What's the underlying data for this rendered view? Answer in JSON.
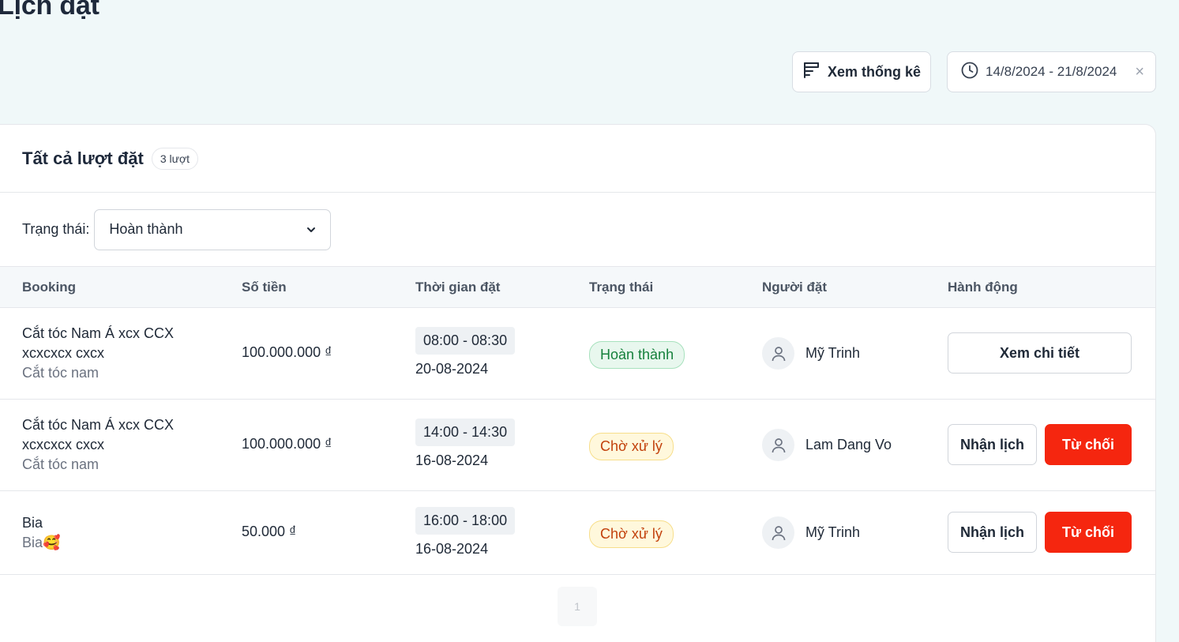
{
  "page": {
    "title": "Lịch đặt"
  },
  "toolbar": {
    "stats_label": "Xem thống kê",
    "date_range": "14/8/2024 - 21/8/2024",
    "clear_symbol": "×"
  },
  "card": {
    "title": "Tất cả lượt đặt",
    "count_badge": "3 lượt",
    "filter_label": "Trạng thái:",
    "filter_value": "Hoàn thành"
  },
  "table": {
    "headers": [
      "Booking",
      "Số tiền",
      "Thời gian đặt",
      "Trạng thái",
      "Người đặt",
      "Hành động"
    ],
    "rows": [
      {
        "name": "Cắt tóc Nam Á xcx CCX xcxcxcx cxcx",
        "sub": "Cắt tóc nam",
        "amount": "100.000.000 ₫",
        "time": "08:00 - 08:30",
        "date": "20-08-2024",
        "status": "Hoàn thành",
        "user": "Mỹ Trinh",
        "actions": [
          "Xem chi tiết"
        ]
      },
      {
        "name": "Cắt tóc Nam Á xcx CCX xcxcxcx cxcx",
        "sub": "Cắt tóc nam",
        "amount": "100.000.000 ₫",
        "time": "14:00 - 14:30",
        "date": "16-08-2024",
        "status": "Chờ xử lý",
        "user": "Lam Dang Vo",
        "actions": [
          "Nhận lịch",
          "Từ chối"
        ]
      },
      {
        "name": "Bia",
        "sub": "Bia🥰",
        "amount": "50.000 ₫",
        "time": "16:00 - 18:00",
        "date": "16-08-2024",
        "status": "Chờ xử lý",
        "user": "Mỹ Trinh",
        "actions": [
          "Nhận lịch",
          "Từ chối"
        ]
      }
    ]
  },
  "pagination": {
    "current_page": "1"
  },
  "colors": {
    "background": "#f0f8f9",
    "reject": "#f5260f",
    "status_done_text": "#16803c",
    "status_pending_text": "#c2410c"
  },
  "icons": [
    "stats-filter-icon",
    "clock-icon",
    "chevron-down-icon",
    "user-avatar-icon"
  ]
}
